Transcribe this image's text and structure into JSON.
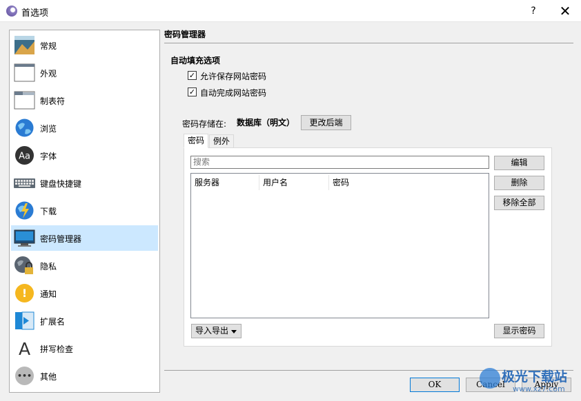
{
  "window": {
    "title": "首选项",
    "help": "?",
    "close": "✕"
  },
  "sidebar": {
    "items": [
      {
        "label": "常规",
        "icon": "general-icon"
      },
      {
        "label": "外观",
        "icon": "appearance-icon"
      },
      {
        "label": "制表符",
        "icon": "tabs-icon"
      },
      {
        "label": "浏览",
        "icon": "browse-icon"
      },
      {
        "label": "字体",
        "icon": "font-icon",
        "glyph": "Aa"
      },
      {
        "label": "键盘快捷键",
        "icon": "keyboard-icon"
      },
      {
        "label": "下载",
        "icon": "download-icon"
      },
      {
        "label": "密码管理器",
        "icon": "password-manager-icon",
        "selected": true
      },
      {
        "label": "隐私",
        "icon": "privacy-icon"
      },
      {
        "label": "通知",
        "icon": "notification-icon",
        "glyph": "!"
      },
      {
        "label": "扩展名",
        "icon": "extensions-icon"
      },
      {
        "label": "拼写检查",
        "icon": "spellcheck-icon",
        "glyph": "A"
      },
      {
        "label": "其他",
        "icon": "other-icon",
        "glyph": "•••"
      }
    ]
  },
  "main": {
    "section_title": "密码管理器",
    "autofill": {
      "title": "自动填充选项",
      "options": [
        {
          "label": "允许保存网站密码",
          "checked": true
        },
        {
          "label": "自动完成网站密码",
          "checked": true
        }
      ]
    },
    "storage": {
      "label": "密码存储在:",
      "value": "数据库（明文）",
      "change_button": "更改后端"
    },
    "tabs": [
      {
        "label": "密码",
        "active": true
      },
      {
        "label": "例外",
        "active": false
      }
    ],
    "search": {
      "placeholder": "搜索"
    },
    "table": {
      "columns": [
        "服务器",
        "用户名",
        "密码"
      ],
      "rows": []
    },
    "side_buttons": {
      "edit": "编辑",
      "delete": "删除",
      "remove_all": "移除全部"
    },
    "import_export": "导入导出",
    "show_passwords": "显示密码"
  },
  "footer": {
    "ok": "OK",
    "cancel": "Cancel",
    "apply": "Apply"
  },
  "watermark": {
    "text": "极光下载站",
    "url": "www.xz7.com"
  },
  "colors": {
    "selected_bg": "#cce8ff",
    "default_border": "#0078d7",
    "watermark": "#1e63b5"
  }
}
